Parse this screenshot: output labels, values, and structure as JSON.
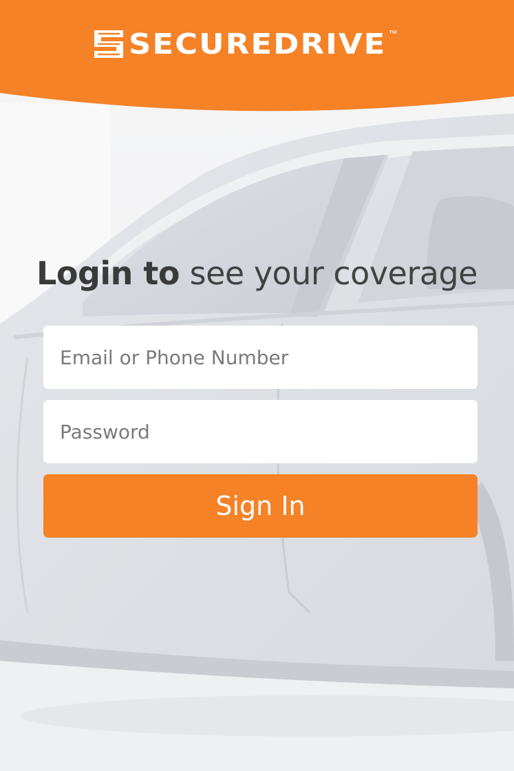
{
  "brand": {
    "name": "SECUREDRIVE",
    "trademark": "™",
    "logo_icon": "securedrive-s-mark-icon",
    "color": "#f58226"
  },
  "login": {
    "headline_strong": "Login to",
    "headline_light": "see your coverage",
    "email_placeholder": "Email or Phone Number",
    "password_placeholder": "Password",
    "submit_label": "Sign In"
  },
  "colors": {
    "accent": "#f58226",
    "field_background": "#ffffff",
    "page_background": "#f1f2f4",
    "headline_text": "#3a3a3a"
  }
}
